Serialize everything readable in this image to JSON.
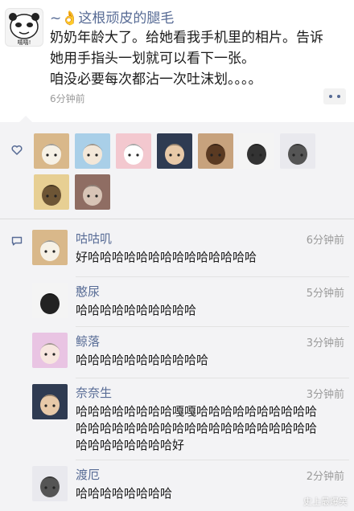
{
  "post": {
    "author": "~👌这根顽皮的腿毛",
    "avatar_icon": "panda-meme-avatar",
    "avatar_text": "嘻嘻!",
    "lines": [
      "奶奶年龄大了。给她看我手机里的相片。告诉",
      "她用手指头一划就可以看下一张。",
      "咱没必要每次都沾一次吐沫划。。。。"
    ],
    "time": "6分钟前",
    "more_icon": "more-dots-icon"
  },
  "likes": {
    "icon": "heart-outline-icon",
    "avatars": [
      {
        "name": "shiba-dog-avatar",
        "bg": "#d9b88a",
        "fg": "#f6f1e6"
      },
      {
        "name": "anime-boy-blue-avatar",
        "bg": "#a9cfe8",
        "fg": "#f3e7d8"
      },
      {
        "name": "pink-pig-avatar",
        "bg": "#f3c8cf",
        "fg": "#ffffff"
      },
      {
        "name": "dark-hair-boy-avatar",
        "bg": "#2f3b52",
        "fg": "#e8c9a8"
      },
      {
        "name": "child-photo-avatar",
        "bg": "#c7a27d",
        "fg": "#5a3a22"
      },
      {
        "name": "sketch-boy-avatar",
        "bg": "#f4f4f4",
        "fg": "#333333"
      },
      {
        "name": "manga-face-avatar",
        "bg": "#e9e9ee",
        "fg": "#555555"
      },
      {
        "name": "blonde-boy-avatar",
        "bg": "#e7cf93",
        "fg": "#6d5535"
      },
      {
        "name": "photo-person-avatar",
        "bg": "#8f6d63",
        "fg": "#d8c4b6"
      }
    ]
  },
  "comments": [
    {
      "name": "咕咕叽",
      "time": "6分钟前",
      "avatar": "shiba-dog-avatar",
      "bg": "#d9b88a",
      "fg": "#f6f1e6",
      "lines": [
        "好哈哈哈哈哈哈哈哈哈哈哈哈哈哈"
      ]
    },
    {
      "name": "憨尿",
      "time": "5分钟前",
      "avatar": "panda-meme-avatar",
      "bg": "#f4f4f4",
      "fg": "#222222",
      "lines": [
        "哈哈哈哈哈哈哈哈哈哈"
      ]
    },
    {
      "name": "鲸落",
      "time": "3分钟前",
      "avatar": "pink-hair-girl-avatar",
      "bg": "#e9c4e3",
      "fg": "#f7e6df",
      "lines": [
        "哈哈哈哈哈哈哈哈哈哈哈"
      ]
    },
    {
      "name": "奈奈生",
      "time": "3分钟前",
      "avatar": "dark-hair-boy-avatar",
      "bg": "#2f3b52",
      "fg": "#e8c9a8",
      "lines": [
        "哈哈哈哈哈哈哈哈嘎嘎哈哈哈哈哈哈哈哈哈哈",
        "哈哈哈哈哈哈哈哈哈哈哈哈哈哈哈哈哈哈哈哈",
        "哈哈哈哈哈哈哈哈好"
      ]
    },
    {
      "name": "渡厄",
      "time": "2分钟前",
      "avatar": "manga-face-avatar",
      "bg": "#e9e9ee",
      "fg": "#555555",
      "lines": [
        "哈哈哈哈哈哈哈哈"
      ]
    }
  ],
  "comment_icon": "comment-bubble-icon",
  "watermark": "史上最爆笑"
}
